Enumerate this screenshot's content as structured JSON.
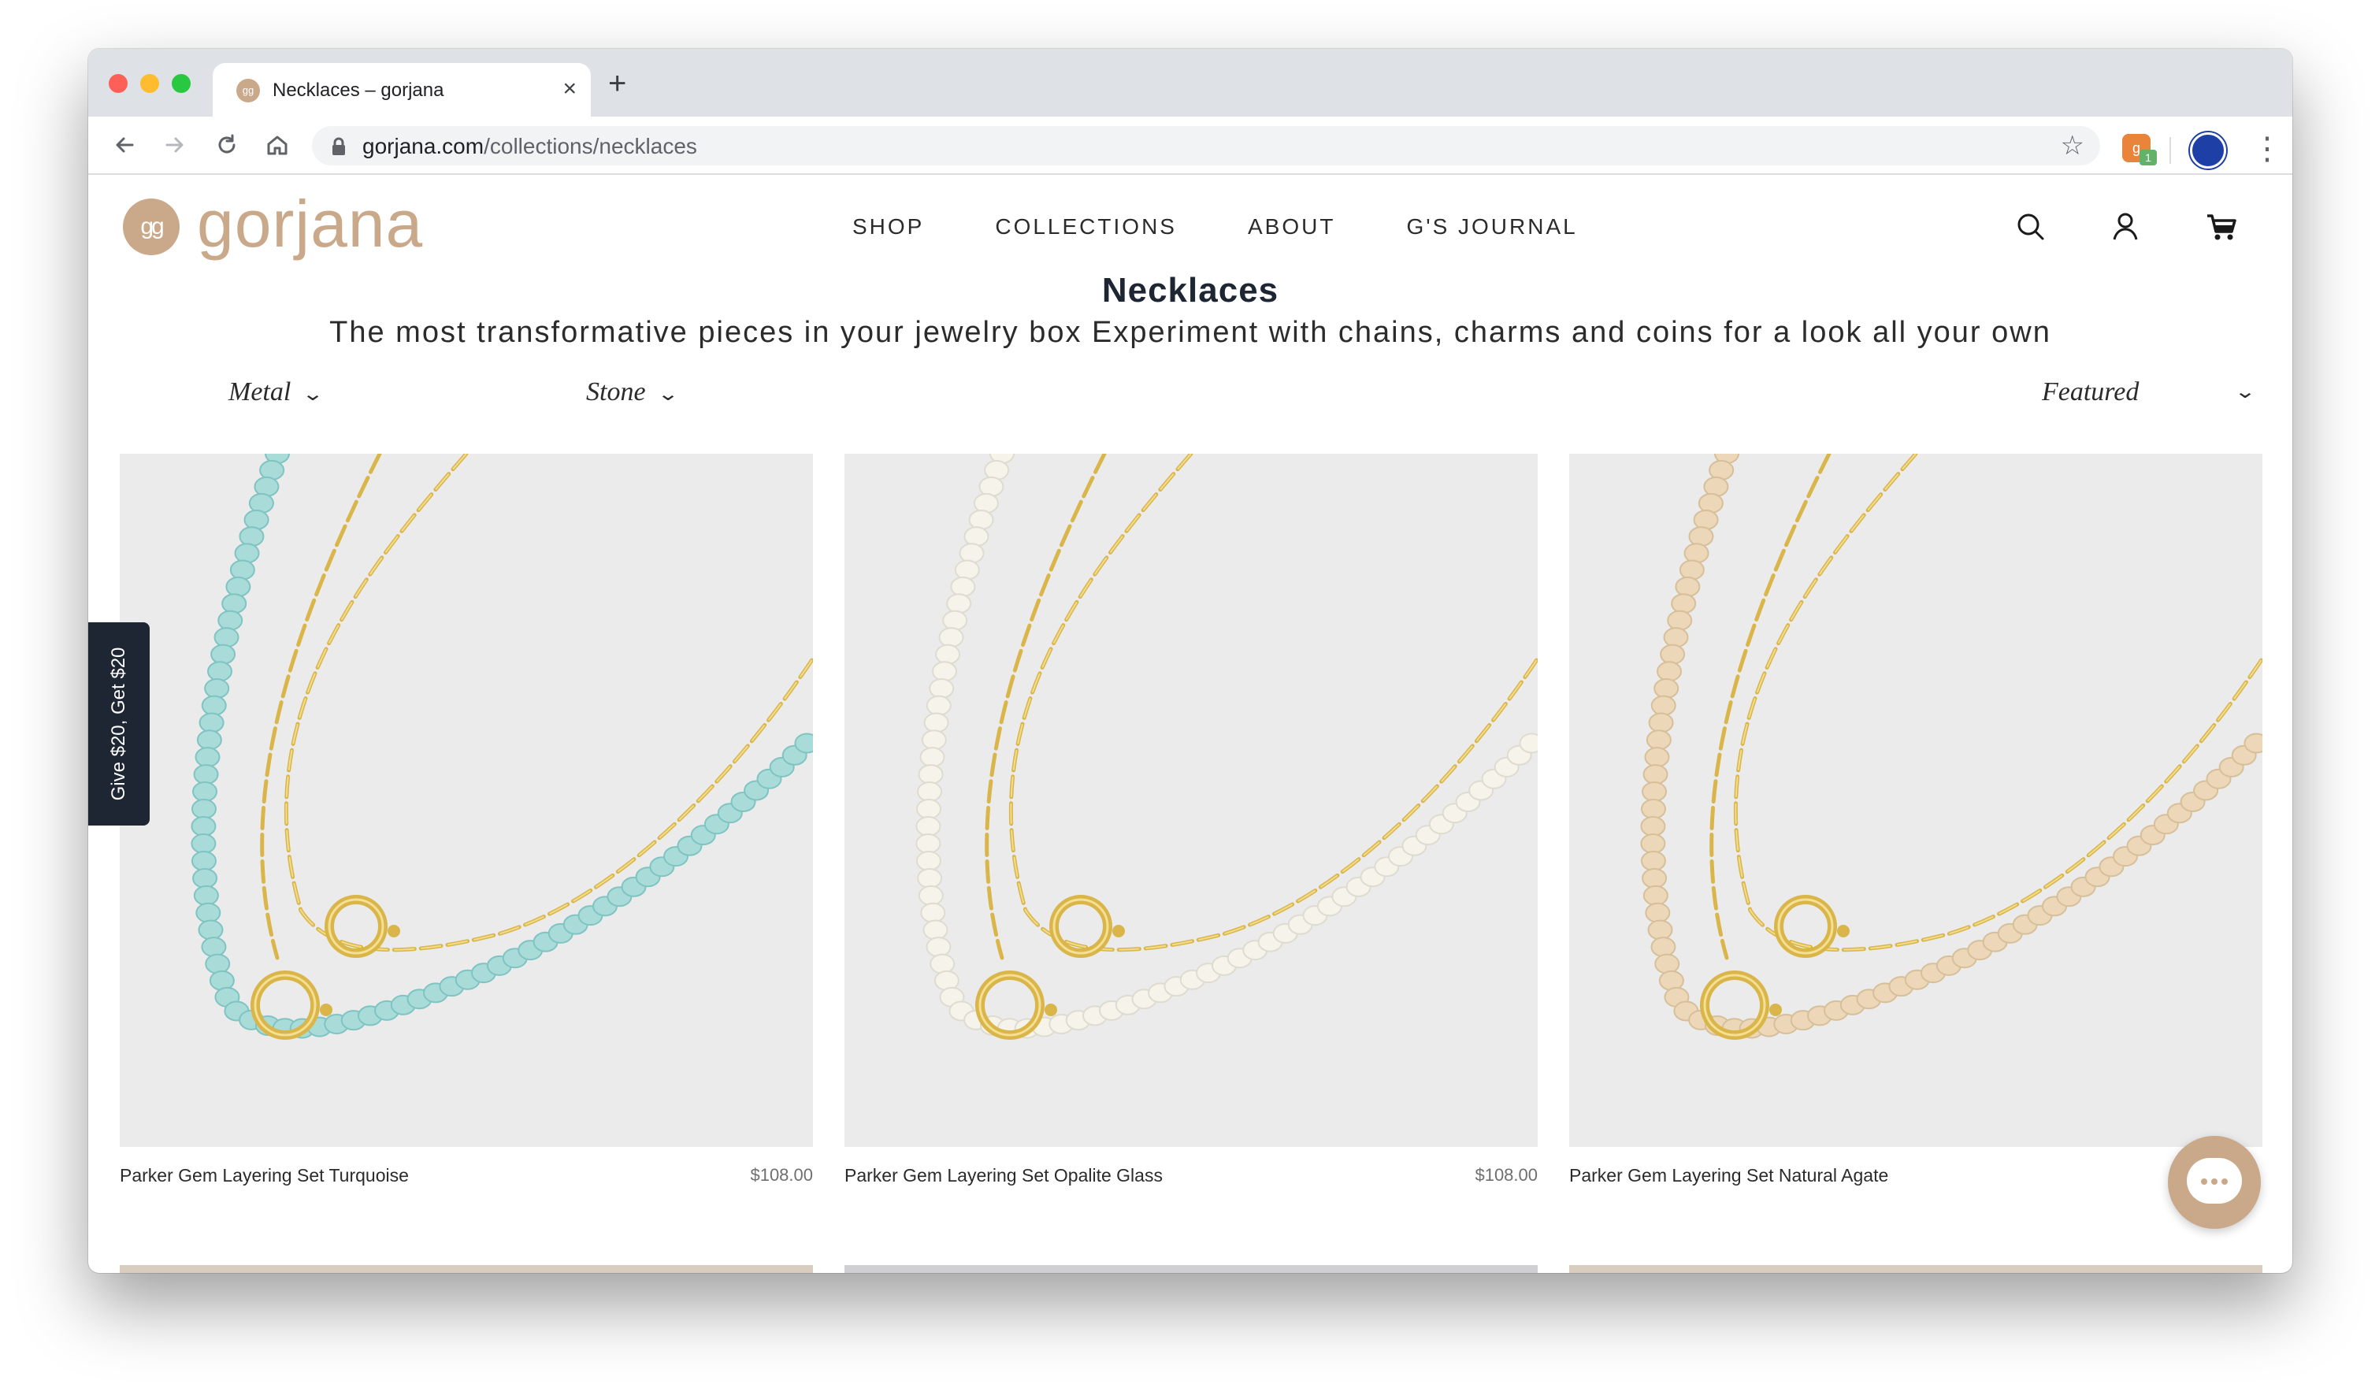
{
  "browser": {
    "tab_title": "Necklaces – gorjana",
    "url_host": "gorjana.com",
    "url_path": "/collections/necklaces",
    "extension_badge": "1"
  },
  "site": {
    "logo_text": "gorjana",
    "logo_mark": "gg",
    "nav": [
      "SHOP",
      "COLLECTIONS",
      "ABOUT",
      "G'S JOURNAL"
    ],
    "icons": [
      "search-icon",
      "account-icon",
      "cart-icon"
    ]
  },
  "page": {
    "title": "Necklaces",
    "subtitle": "The most transformative pieces in your jewelry box Experiment with chains, charms and coins for a look all your own"
  },
  "filters": {
    "metal": "Metal",
    "stone": "Stone",
    "sort": "Featured"
  },
  "products": [
    {
      "name": "Parker Gem Layering Set Turquoise",
      "price": "$108.00",
      "bead_color": "#a9dcd9",
      "bead_shade": "#7fc4c2"
    },
    {
      "name": "Parker Gem Layering Set Opalite Glass",
      "price": "$108.00",
      "bead_color": "#f6f3ea",
      "bead_shade": "#dedbd0"
    },
    {
      "name": "Parker Gem Layering Set Natural Agate",
      "price": "",
      "bead_color": "#ecd8b8",
      "bead_shade": "#d6bf99"
    }
  ],
  "referral_tab": "Give $20, Get $20",
  "colors": {
    "brand": "#c9a98a",
    "navy": "#1e2634",
    "gold": "#d9b54a",
    "image_bg": "#ebebeb"
  }
}
